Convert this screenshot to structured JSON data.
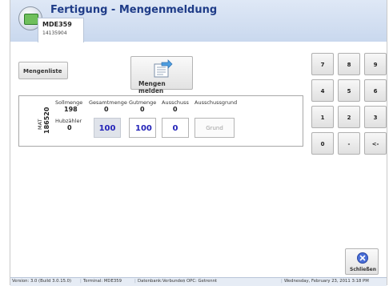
{
  "app": {
    "title": "Fertigung - Mengenmeldung",
    "station_name": "MDE359",
    "station_id": "14135904"
  },
  "toolbar": {
    "mengenliste_label": "Mengenliste",
    "mengen_melden_label": "Mengen melden"
  },
  "entry": {
    "side_label": "MAT",
    "side_id": "186520",
    "columns": {
      "sollmenge": "Sollmenge",
      "gesamtmenge": "Gesamtmenge",
      "gutmenge": "Gutmenge",
      "ausschuss": "Ausschuss",
      "ausschussgrund": "Ausschussgrund"
    },
    "sollmenge_value": "198",
    "gesamtmenge_value": "0",
    "gutmenge_value": "0",
    "ausschuss_value": "0",
    "hubzaehler_label": "Hubzähler",
    "hubzaehler_value": "0",
    "gesamtmenge_box": "100",
    "gutmenge_input": "100",
    "ausschuss_input": "0",
    "grund_button": "Grund"
  },
  "keypad": {
    "keys": [
      "7",
      "8",
      "9",
      "4",
      "5",
      "6",
      "1",
      "2",
      "3",
      "0",
      "-",
      "<-"
    ]
  },
  "close_label": "Schließen",
  "status": {
    "version": "Version: 3.0 (Build 3.0.15.0)",
    "terminal": "Terminal: MDE359",
    "database": "Datenbank:Verbunden",
    "opc": "OPC: Getrennt",
    "datetime": "Wednesday, February 23, 2011 3:18 PM"
  },
  "colors": {
    "title": "#1f3c88",
    "value_blue": "#2323b8",
    "titlebar": "#d6e2f3"
  },
  "icons": {
    "app": "production-app-icon",
    "send": "send-quantity-icon",
    "close": "close-icon"
  }
}
